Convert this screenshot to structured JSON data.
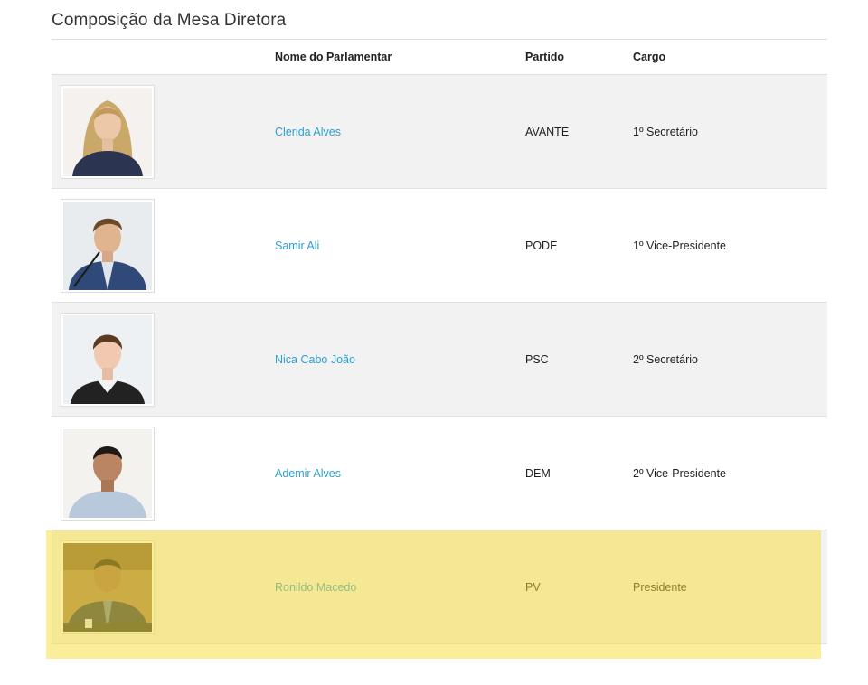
{
  "page": {
    "title": "Composição da Mesa Diretora"
  },
  "table": {
    "headers": {
      "photo": "",
      "name": "Nome do Parlamentar",
      "party": "Partido",
      "role": "Cargo"
    },
    "rows": [
      {
        "name": "Clerida Alves",
        "party": "AVANTE",
        "role": "1º Secretário",
        "photo_icon": "member-photo"
      },
      {
        "name": "Samir Ali",
        "party": "PODE",
        "role": "1º Vice-Presidente",
        "photo_icon": "member-photo"
      },
      {
        "name": "Nica Cabo João",
        "party": "PSC",
        "role": "2º Secretário",
        "photo_icon": "member-photo"
      },
      {
        "name": "Ademir Alves",
        "party": "DEM",
        "role": "2º Vice-Presidente",
        "photo_icon": "member-photo"
      },
      {
        "name": "Ronildo Macedo",
        "party": "PV",
        "role": "Presidente",
        "photo_icon": "member-photo",
        "highlighted": true
      }
    ]
  },
  "colors": {
    "link": "#2d9fd0",
    "row_stripe": "#f2f2f2",
    "highlight": "#f7de35"
  }
}
